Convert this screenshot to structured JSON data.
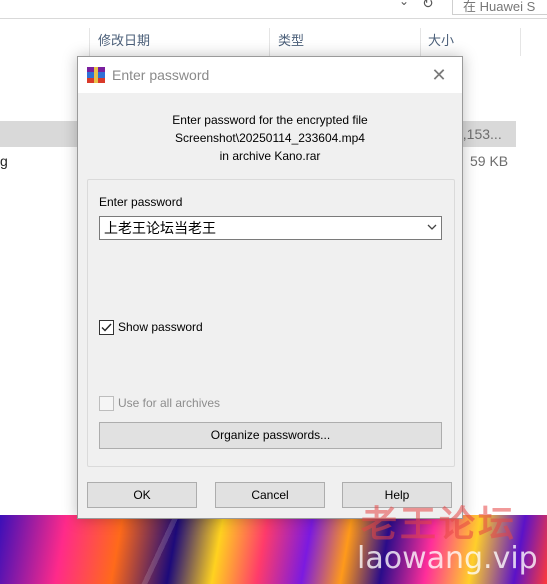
{
  "explorer": {
    "search_placeholder": "在 Huawei S",
    "columns": {
      "date": "修改日期",
      "type": "类型",
      "size": "大小"
    },
    "rows": [
      {
        "name": "",
        "size": "4,153..."
      },
      {
        "name": "g",
        "size": "59 KB"
      }
    ]
  },
  "dialog": {
    "title": "Enter password",
    "prompt_line1": "Enter password for the encrypted file",
    "prompt_line2": "Screenshot\\20250114_233604.mp4",
    "prompt_line3": "in archive Kano.rar",
    "password_label": "Enter password",
    "password_value": "上老王论坛当老王",
    "show_password_label": "Show password",
    "show_password_checked": true,
    "use_all_label": "Use for all archives",
    "use_all_checked": false,
    "organize_label": "Organize passwords...",
    "ok_label": "OK",
    "cancel_label": "Cancel",
    "help_label": "Help"
  },
  "watermark": {
    "cn": "老王论坛",
    "en": "laowang.vip"
  },
  "colors": {
    "dialog_bg": "#f0f0f0",
    "button_bg": "#e1e1e1",
    "selection": "#d9d9d9"
  },
  "icons": [
    "winrar-icon",
    "close-icon",
    "chevron-down-icon",
    "refresh-icon",
    "check-icon"
  ]
}
